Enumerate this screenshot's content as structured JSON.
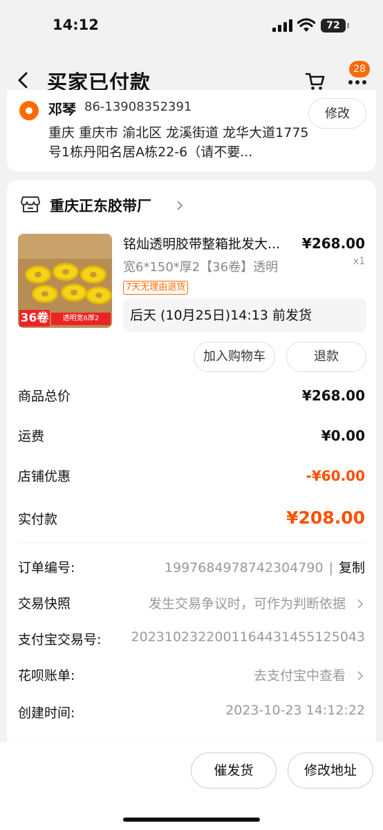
{
  "status_bar": {
    "time": "14:12",
    "battery": "72"
  },
  "nav": {
    "title": "买家已付款",
    "badge_count": "28"
  },
  "address": {
    "name": "邓琴",
    "phone": "86-13908352391",
    "text": "重庆 重庆市 渝北区 龙溪街道 龙华大道1775号1栋丹阳名居A栋22-6（请不要...",
    "edit_label": "修改"
  },
  "shop": {
    "name": "重庆正东胶带厂"
  },
  "product": {
    "title": "铭灿透明胶带整箱批发大...",
    "price": "¥268.00",
    "sku": "宽6*150*厚2【36卷】透明",
    "qty": "x1",
    "return_tag": "7天无理由退货",
    "shipping": "后天 (10月25日)14:13 前发货",
    "image_tag_count": "36卷",
    "image_tag_text": "透明宽6厚2",
    "add_cart_label": "加入购物车",
    "refund_label": "退款"
  },
  "summary": {
    "goods_total_label": "商品总价",
    "goods_total_value": "¥268.00",
    "shipping_label": "运费",
    "shipping_value": "¥0.00",
    "shop_discount_label": "店铺优惠",
    "shop_discount_value": "-¥60.00",
    "paid_label": "实付款",
    "paid_value": "¥208.00"
  },
  "order_info": {
    "order_no_label": "订单编号:",
    "order_no_value": "1997684978742304790",
    "copy_label": "复制",
    "snapshot_label": "交易快照",
    "snapshot_value": "发生交易争议时，可作为判断依据",
    "alipay_no_label": "支付宝交易号:",
    "alipay_no_value": "2023102322001164431455125043",
    "huabei_label": "花呗账单:",
    "huabei_value": "去支付宝中查看",
    "created_label": "创建时间:",
    "created_value": "2023-10-23 14:12:22"
  },
  "bottom": {
    "urge_label": "催发货",
    "edit_addr_label": "修改地址"
  },
  "colors": {
    "accent": "#ff5000",
    "badge": "#ff6a00"
  }
}
